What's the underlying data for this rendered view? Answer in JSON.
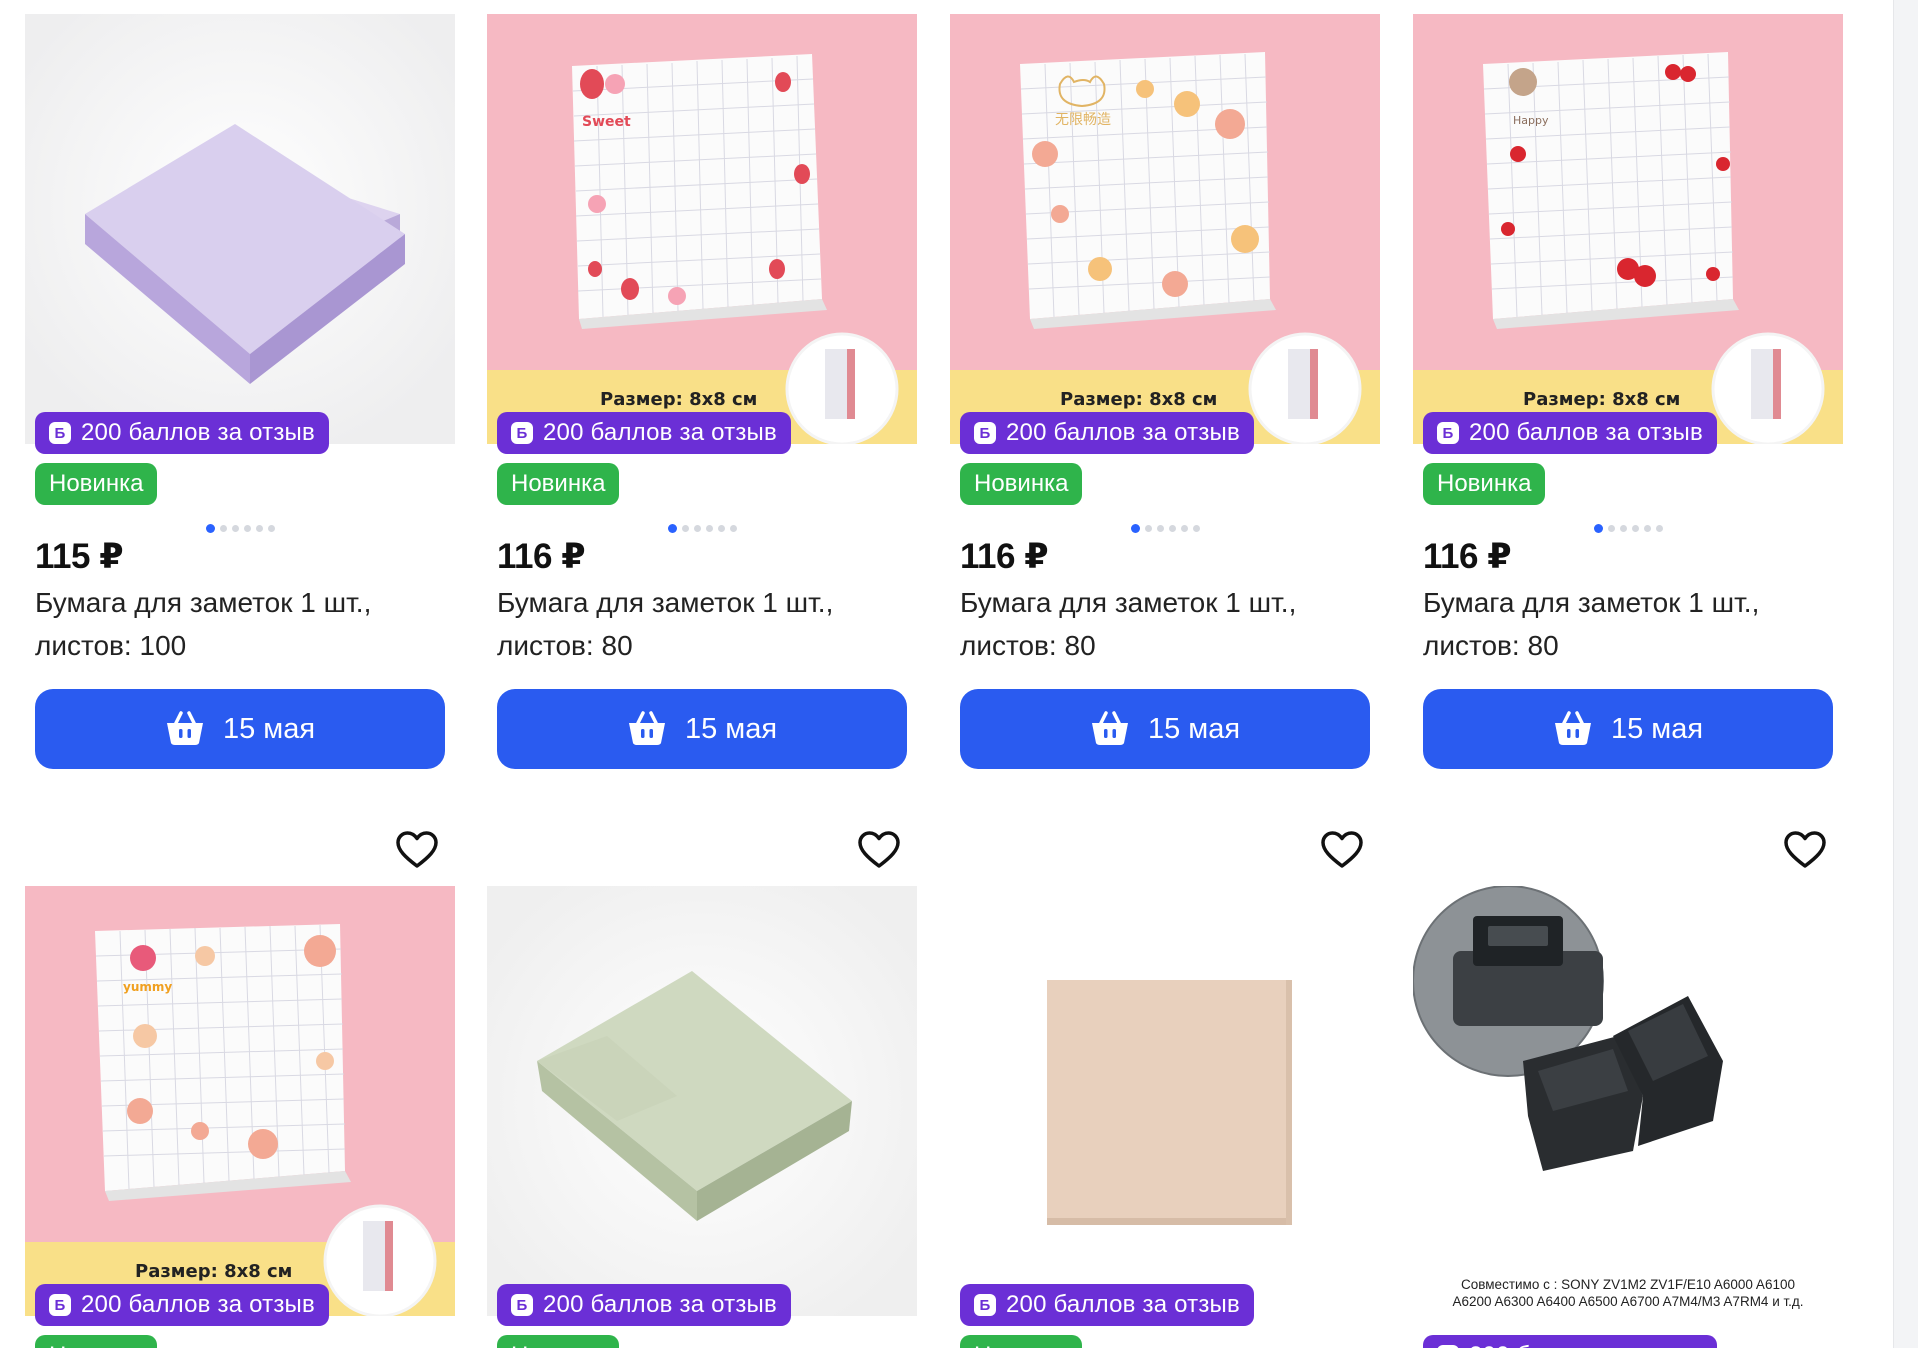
{
  "currency": "₽",
  "points_badge": "200 баллов за отзыв",
  "points_icon_letter": "Б",
  "new_badge": "Новинка",
  "size_label": "Размер: 8х8 см",
  "row1": [
    {
      "price": "115 ₽",
      "title_line1": "Бумага для заметок 1 шт.,",
      "title_line2": "листов: 100",
      "delivery": "15 мая"
    },
    {
      "price": "116 ₽",
      "title_line1": "Бумага для заметок 1 шт.,",
      "title_line2": "листов: 80",
      "delivery": "15 мая"
    },
    {
      "price": "116 ₽",
      "title_line1": "Бумага для заметок 1 шт.,",
      "title_line2": "листов: 80",
      "delivery": "15 мая"
    },
    {
      "price": "116 ₽",
      "title_line1": "Бумага для заметок 1 шт.,",
      "title_line2": "листов: 80",
      "delivery": "15 мая"
    }
  ],
  "image_texts": {
    "sweet": "Sweet",
    "happy": "Happy",
    "yummy": "yummy",
    "chinese": "无限畅造",
    "compat_line1": "Совместимо с : SONY ZV1M2 ZV1F/E10 A6000 A6100",
    "compat_line2": "A6200 A6300 A6400 A6500 A6700 A7M4/M3 A7RM4 и т.д."
  },
  "icons": {
    "heart": "heart-icon",
    "basket": "basket-icon",
    "points": "points-b-icon"
  },
  "colors": {
    "accent_blue": "#2a5bf0",
    "points_purple": "#6b2fd6",
    "new_green": "#2fb44b",
    "pink_bg": "#f6b9c3",
    "banner_yellow": "#f9e088"
  }
}
